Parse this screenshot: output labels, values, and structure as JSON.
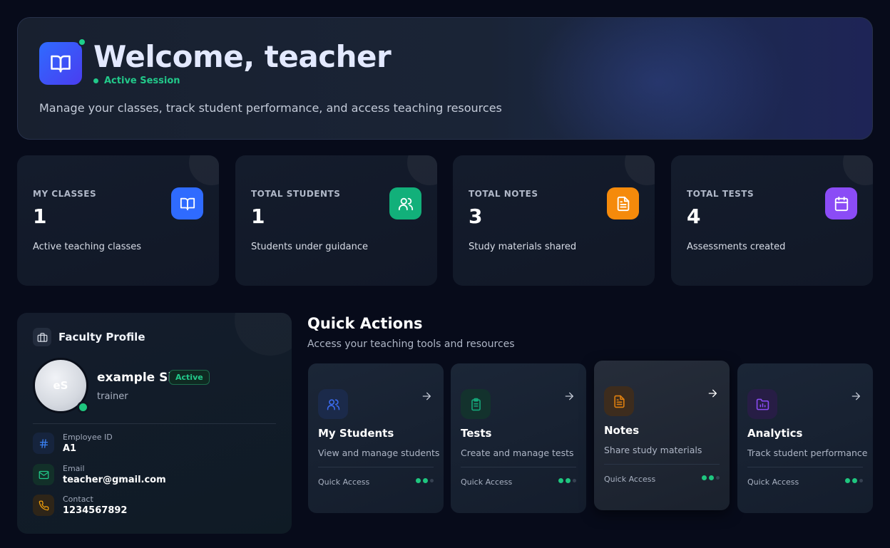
{
  "hero": {
    "title": "Welcome, teacher",
    "status": "Active Session",
    "subtitle": "Manage your classes, track student performance, and access teaching resources"
  },
  "stats": [
    {
      "label": "MY CLASSES",
      "value": "1",
      "desc": "Active teaching classes",
      "icon": "book-icon",
      "color": "#2f6bff"
    },
    {
      "label": "TOTAL STUDENTS",
      "value": "1",
      "desc": "Students under guidance",
      "icon": "users-icon",
      "color": "#12b07a"
    },
    {
      "label": "TOTAL NOTES",
      "value": "3",
      "desc": "Study materials shared",
      "icon": "file-text-icon",
      "color": "#f58a0b"
    },
    {
      "label": "TOTAL TESTS",
      "value": "4",
      "desc": "Assessments created",
      "icon": "calendar-icon",
      "color": "#8b4cf6"
    }
  ],
  "profile": {
    "heading": "Faculty Profile",
    "initials": "eS",
    "name": "example Sir",
    "badge": "Active",
    "role": "trainer",
    "fields": [
      {
        "label": "Employee ID",
        "value": "A1",
        "icon": "hash-icon",
        "color": "#3b82f6"
      },
      {
        "label": "Email",
        "value": "teacher@gmail.com",
        "icon": "mail-icon",
        "color": "#22c98a"
      },
      {
        "label": "Contact",
        "value": "1234567892",
        "icon": "phone-icon",
        "color": "#f5a20b"
      }
    ]
  },
  "quick_actions": {
    "title": "Quick Actions",
    "subtitle": "Access your teaching tools and resources",
    "cards": [
      {
        "name": "My Students",
        "desc": "View and manage students",
        "footer": "Quick Access",
        "icon": "users-icon",
        "color": "#3b6cf0"
      },
      {
        "name": "Tests",
        "desc": "Create and manage tests",
        "footer": "Quick Access",
        "icon": "clipboard-icon",
        "color": "#15a77a"
      },
      {
        "name": "Notes",
        "desc": "Share study materials",
        "footer": "Quick Access",
        "icon": "file-text-icon",
        "color": "#e0800f"
      },
      {
        "name": "Analytics",
        "desc": "Track student performance",
        "footer": "Quick Access",
        "icon": "folder-chart-icon",
        "color": "#8b4cf6"
      }
    ]
  }
}
